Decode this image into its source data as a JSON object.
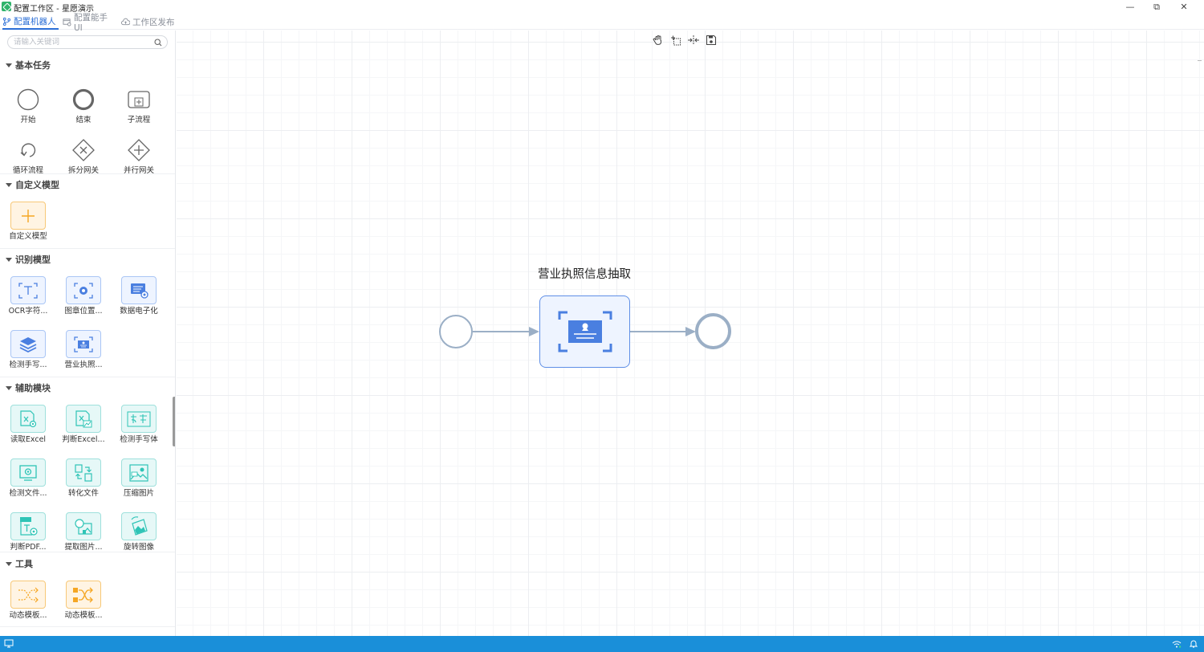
{
  "window": {
    "title": "配置工作区 - 星愿演示",
    "minimize_glyph": "—",
    "maximize_glyph": "⧉",
    "close_glyph": "✕"
  },
  "tabs": [
    {
      "label": "配置机器人",
      "active": true,
      "icon": "branch-icon"
    },
    {
      "label": "配置能手 UI",
      "active": false,
      "icon": "window-icon"
    },
    {
      "label": "工作区发布",
      "active": false,
      "icon": "cloud-icon"
    }
  ],
  "search": {
    "placeholder": "请输入关键词",
    "value": ""
  },
  "sections": {
    "basic": {
      "title": "基本任务",
      "items": [
        {
          "label": "开始",
          "icon": "start-circle-icon"
        },
        {
          "label": "结束",
          "icon": "end-circle-icon"
        },
        {
          "label": "子流程",
          "icon": "subprocess-icon"
        },
        {
          "label": "循环流程",
          "icon": "loop-icon"
        },
        {
          "label": "拆分网关",
          "icon": "exclusive-gateway-icon"
        },
        {
          "label": "并行网关",
          "icon": "parallel-gateway-icon"
        }
      ]
    },
    "custom": {
      "title": "自定义模型",
      "items": [
        {
          "label": "自定义模型",
          "icon": "plus-icon"
        }
      ]
    },
    "recognition": {
      "title": "识别模型",
      "items": [
        {
          "label": "OCR字符...",
          "icon": "ocr-text-icon"
        },
        {
          "label": "图章位置...",
          "icon": "stamp-position-icon"
        },
        {
          "label": "数据电子化",
          "icon": "data-digitize-icon"
        },
        {
          "label": "检测手写...",
          "icon": "layers-icon"
        },
        {
          "label": "营业执照...",
          "icon": "license-icon"
        }
      ]
    },
    "auxiliary": {
      "title": "辅助模块",
      "items": [
        {
          "label": "读取Excel",
          "icon": "read-excel-icon"
        },
        {
          "label": "判断Excel...",
          "icon": "check-excel-icon"
        },
        {
          "label": "检测手写体",
          "icon": "handwriting-icon"
        },
        {
          "label": "检测文件...",
          "icon": "detect-file-icon"
        },
        {
          "label": "转化文件",
          "icon": "convert-file-icon"
        },
        {
          "label": "压缩图片",
          "icon": "compress-image-icon"
        },
        {
          "label": "判断PDF...",
          "icon": "check-pdf-icon"
        },
        {
          "label": "提取图片...",
          "icon": "extract-image-icon"
        },
        {
          "label": "旋转图像",
          "icon": "rotate-image-icon"
        }
      ]
    },
    "tools": {
      "title": "工具",
      "items": [
        {
          "label": "动态模板...",
          "icon": "dynamic-template-icon"
        },
        {
          "label": "动态模板...",
          "icon": "dynamic-template-shuffle-icon"
        }
      ]
    }
  },
  "canvas": {
    "toolbar": [
      "hand-icon",
      "select-area-icon",
      "split-icon",
      "save-icon"
    ],
    "task_node_title": "营业执照信息抽取",
    "task_node_icon": "license-icon"
  },
  "colors": {
    "accent": "#2c6fd6",
    "statusbar": "#1a8fd9",
    "node_border": "#5f8fe6",
    "flow_gray": "#9bafc6"
  }
}
